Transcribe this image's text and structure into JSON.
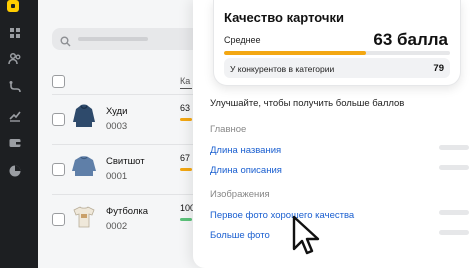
{
  "colors": {
    "sidebar": "#1d1f22",
    "accent": "#ffcc00",
    "link": "#1a5fd0",
    "progress": "#f3a712",
    "score_green": "#5cc27a"
  },
  "sidebar": {
    "icons": [
      "logo-icon",
      "grid-icon",
      "people-icon",
      "route-icon",
      "trend-icon",
      "wallet-icon",
      "pie-chart-icon"
    ]
  },
  "list": {
    "column_header": "Ка",
    "rows": [
      {
        "name": "Худи",
        "code": "0003",
        "score": "63",
        "bar_color": "#f3a712"
      },
      {
        "name": "Свитшот",
        "code": "0001",
        "score": "67",
        "bar_color": "#f3a712"
      },
      {
        "name": "Футболка",
        "code": "0002",
        "score": "100",
        "bar_color": "#5cc27a"
      }
    ]
  },
  "card_quality": {
    "title": "Качество карточки",
    "level": "Среднее",
    "score": "63 балла",
    "progress": 0.63,
    "competitors_label": "У конкурентов в категории",
    "competitors_value": "79"
  },
  "improve": {
    "heading": "Улучшайте, чтобы получить больше баллов",
    "sections": [
      {
        "title": "Главное",
        "items": [
          "Длина названия",
          "Длина описания"
        ]
      },
      {
        "title": "Изображения",
        "items": [
          "Первое фото хорошего качества",
          "Больше фото"
        ]
      }
    ]
  }
}
